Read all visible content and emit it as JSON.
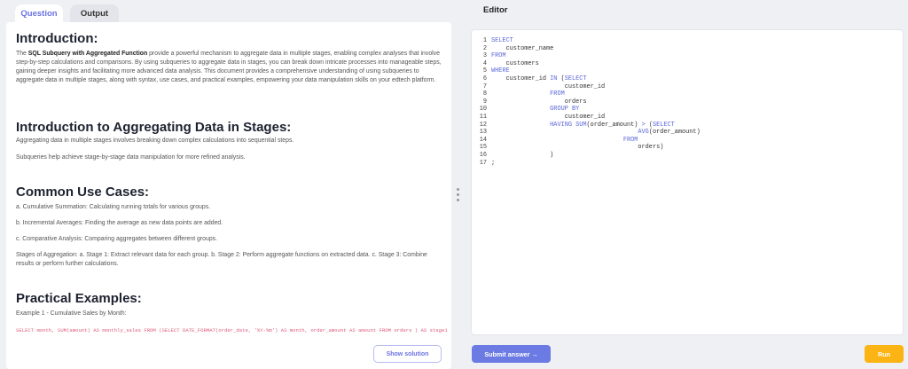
{
  "tabs": {
    "question": "Question",
    "output": "Output"
  },
  "content": {
    "h1": "Introduction:",
    "intro_bold": "SQL Subquery with Aggregated Function",
    "intro_pre": "The ",
    "intro_post": " provide a powerful mechanism to aggregate data in multiple stages, enabling complex analyses that involve step-by-step calculations and comparisons. By using subqueries to aggregate data in stages, you can break down intricate processes into manageable steps, gaining deeper insights and facilitating more advanced data analysis. This document provides a comprehensive understanding of using subqueries to aggregate data in multiple stages, along with syntax, use cases, and practical examples, empowering your data manipulation skills on your edtech platform.",
    "h2": "Introduction to Aggregating Data in Stages:",
    "p2a": "Aggregating data in multiple stages involves breaking down complex calculations into sequential steps.",
    "p2b": "Subqueries help achieve stage-by-stage data manipulation for more refined analysis.",
    "h3": "Common Use Cases:",
    "uc1": "a. Cumulative Summation: Calculating running totals for various groups.",
    "uc2": "b. Incremental Averages: Finding the average as new data points are added.",
    "uc3": "c. Comparative Analysis: Comparing aggregates between different groups.",
    "uc4": "Stages of Aggregation: a. Stage 1: Extract relevant data for each group. b. Stage 2: Perform aggregate functions on extracted data. c. Stage 3: Combine results or perform further calculations.",
    "h4": "Practical Examples:",
    "ex1": "Example 1 - Cumulative Sales by Month:",
    "ex1_code": "SELECT month, SUM(amount) AS monthly_sales FROM (SELECT DATE_FORMAT(order_date, '%Y-%m') AS month, order_amount AS amount FROM orders ) AS stage1",
    "show_solution": "Show solution"
  },
  "editor": {
    "title": "Editor",
    "lines": [
      [
        [
          "SELECT",
          1
        ]
      ],
      [
        [
          "    customer_name",
          0
        ]
      ],
      [
        [
          "FROM",
          1
        ]
      ],
      [
        [
          "    customers",
          0
        ]
      ],
      [
        [
          "WHERE",
          1
        ]
      ],
      [
        [
          "    customer_id ",
          0
        ],
        [
          "IN",
          1
        ],
        [
          " (",
          0
        ],
        [
          "SELECT",
          1
        ]
      ],
      [
        [
          "                    customer_id",
          0
        ]
      ],
      [
        [
          "                ",
          0
        ],
        [
          "FROM",
          1
        ]
      ],
      [
        [
          "                    orders",
          0
        ]
      ],
      [
        [
          "                ",
          0
        ],
        [
          "GROUP BY",
          1
        ]
      ],
      [
        [
          "                    customer_id",
          0
        ]
      ],
      [
        [
          "                ",
          0
        ],
        [
          "HAVING SUM",
          1
        ],
        [
          "(order_amount) ",
          0
        ],
        [
          ">",
          1
        ],
        [
          " (",
          0
        ],
        [
          "SELECT",
          1
        ]
      ],
      [
        [
          "                                        ",
          0
        ],
        [
          "AVG",
          1
        ],
        [
          "(order_amount)",
          0
        ]
      ],
      [
        [
          "                                    ",
          0
        ],
        [
          "FROM",
          1
        ]
      ],
      [
        [
          "                                        orders)",
          0
        ]
      ],
      [
        [
          "                )",
          0
        ]
      ],
      [
        [
          ";",
          0
        ]
      ]
    ],
    "submit": "Submit answer →",
    "run": "Run"
  }
}
